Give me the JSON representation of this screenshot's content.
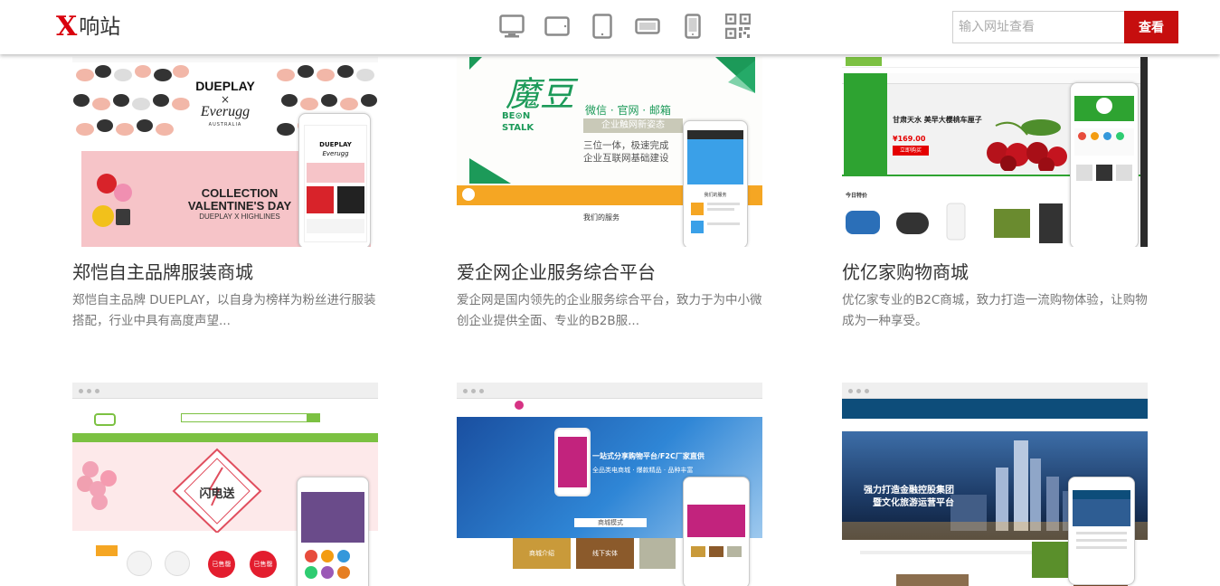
{
  "header": {
    "logo_mark": "X",
    "logo_text": "响站",
    "devices": [
      {
        "icon": "desktop-monitor-icon"
      },
      {
        "icon": "tablet-landscape-icon"
      },
      {
        "icon": "tablet-portrait-icon"
      },
      {
        "icon": "phone-landscape-icon"
      },
      {
        "icon": "phone-portrait-icon"
      },
      {
        "icon": "qr-code-icon"
      }
    ],
    "search": {
      "placeholder": "输入网址查看",
      "button_label": "查看"
    }
  },
  "cards": [
    {
      "title": "郑恺自主品牌服装商城",
      "desc": "郑恺自主品牌 DUEPLAY，以自身为榜样为粉丝进行服装搭配，行业中具有高度声望...",
      "thumb": {
        "brand1": "DUEPLAY",
        "cross": "×",
        "brand2": "Everugg",
        "brand2_sub": "AUSTRALIA",
        "banner1": "COLLECTION",
        "banner2": "VALENTINE'S DAY",
        "banner3": "DUEPLAY X HIGHLINES",
        "phone_brand": "DUEPLAY",
        "phone_brand2": "Everugg"
      }
    },
    {
      "title": "爱企网企业服务综合平台",
      "desc": "爱企网是国内领先的企业服务综合平台，致力于为中小微创企业提供全面、专业的B2B服...",
      "thumb": {
        "logo_cn": "魔豆",
        "logo_en1": "BE⊙N",
        "logo_en2": "STALK",
        "line1": "微信 · 官网 · 邮箱",
        "line2": "企业触网新姿态",
        "line3": "三位一体，极速完成",
        "line4": "企业互联网基础建设",
        "services": "我们的服务",
        "phone_title": "我们的服务"
      }
    },
    {
      "title": "优亿家购物商城",
      "desc": "优亿家专业的B2C商城，致力打造一流购物体验，让购物成为一种享受。",
      "thumb": {
        "promo": "甘肃天水 美早大樱桃车厘子",
        "price": "¥169.00",
        "buy": "立即购买",
        "today": "今日特价"
      }
    }
  ],
  "cards_row2": [
    {
      "thumb": {
        "lightning": "闪电送",
        "sold1": "已售罄",
        "sold2": "已售罄"
      }
    },
    {
      "thumb": {
        "headline": "一站式分享购物平台/F2C厂家直供",
        "sub": "全品类电商城 · 爆款精品 · 品种丰富",
        "section": "商城模式",
        "tag1": "商城介绍",
        "tag2": "线下实体"
      }
    },
    {
      "thumb": {
        "headline": "强力打造金融控股集团",
        "sub": "暨文化旅游运营平台"
      }
    }
  ]
}
